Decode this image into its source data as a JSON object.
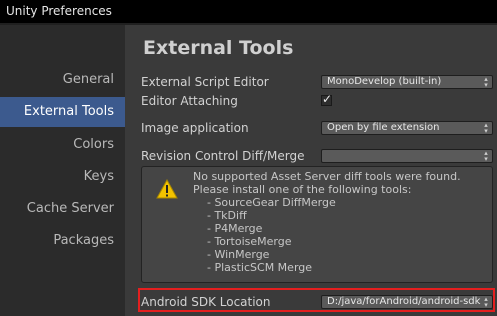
{
  "window": {
    "title": "Unity Preferences"
  },
  "sidebar": {
    "items": [
      {
        "label": "General",
        "active": false
      },
      {
        "label": "External Tools",
        "active": true
      },
      {
        "label": "Colors",
        "active": false
      },
      {
        "label": "Keys",
        "active": false
      },
      {
        "label": "Cache Server",
        "active": false
      },
      {
        "label": "Packages",
        "active": false
      }
    ]
  },
  "main": {
    "title": "External Tools",
    "fields": {
      "script_editor": {
        "label": "External Script Editor",
        "value": "MonoDevelop (built-in)"
      },
      "editor_attaching": {
        "label": "Editor Attaching",
        "checked": true
      },
      "image_application": {
        "label": "Image application",
        "value": "Open by file extension"
      },
      "revision_control": {
        "label": "Revision Control Diff/Merge",
        "value": ""
      },
      "android_sdk": {
        "label": "Android SDK Location",
        "value": "D:/java/forAndroid/android-sdk"
      }
    },
    "help": {
      "lines": [
        "No supported Asset Server diff tools were found.",
        "Please install one of the following tools:",
        "    - SourceGear DiffMerge",
        "    - TkDiff",
        "    - P4Merge",
        "    - TortoiseMerge",
        "    - WinMerge",
        "    - PlasticSCM Merge"
      ]
    }
  },
  "colors": {
    "selection": "#3c5a8e",
    "highlight_border": "#e41f1f",
    "warning": "#f2c200"
  },
  "icons": {
    "warning": "warning-icon",
    "check": "checkmark-icon",
    "dropdown": "dropdown-arrows-icon"
  }
}
